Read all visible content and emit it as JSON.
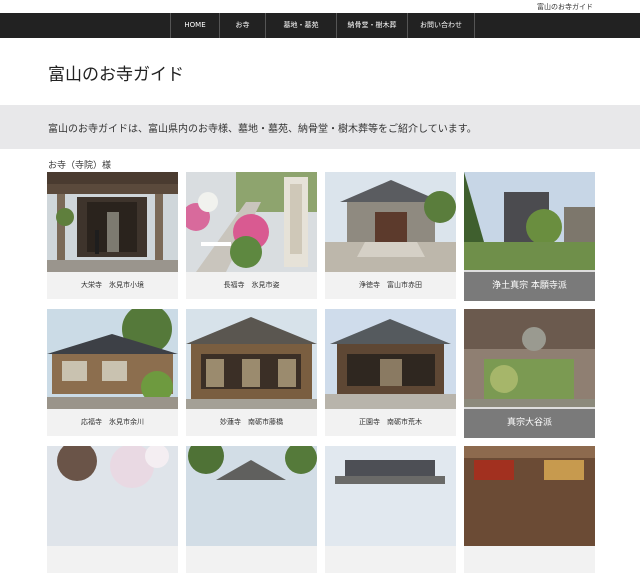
{
  "site_name": "富山のお寺ガイド",
  "nav": [
    "HOME",
    "お寺",
    "墓地・墓苑",
    "納骨堂・樹木葬",
    "お問い合わせ"
  ],
  "header": {
    "title": "富山のお寺ガイド"
  },
  "intro": {
    "text": "富山のお寺ガイドは、富山県内のお寺様、墓地・墓苑、納骨堂・樹木葬等をご紹介しています。"
  },
  "section": {
    "title": "お寺（寺院）様"
  },
  "temples": [
    {
      "caption": "大栄寺　氷見市小境"
    },
    {
      "caption": "長福寺　氷見市姿"
    },
    {
      "caption": "浄徳寺　富山市赤田"
    },
    {
      "caption": "応福寺　氷見市余川"
    },
    {
      "caption": "妙蓮寺　南砺市藤橋"
    },
    {
      "caption": "正園寺　南砺市荒木"
    }
  ],
  "sects": [
    {
      "label": "浄土真宗 本願寺派"
    },
    {
      "label": "真宗大谷派"
    }
  ],
  "colors": {
    "nav_bg": "#222222",
    "intro_bg": "#e8e8ea",
    "band": "#7a7a7a"
  }
}
